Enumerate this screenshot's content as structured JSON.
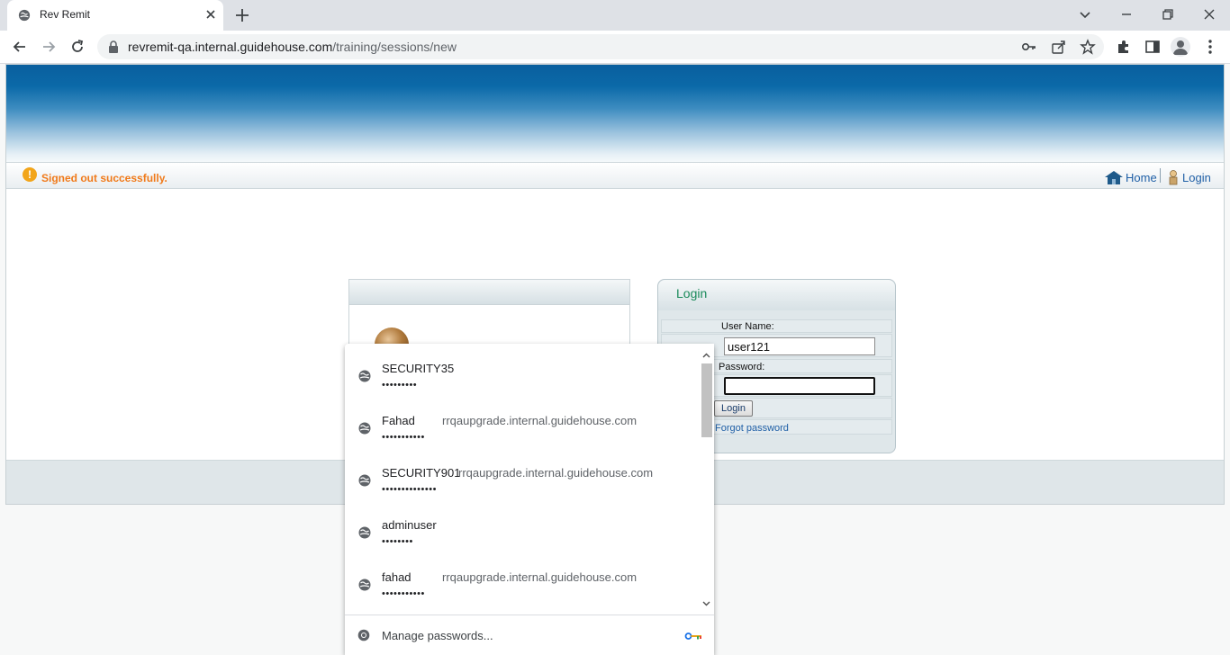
{
  "browser": {
    "tab_title": "Rev Remit",
    "url_host": "revremit-qa.internal.guidehouse.com",
    "url_path": "/training/sessions/new"
  },
  "header": {
    "flash_message": "Signed out successfully.",
    "home_link": "Home",
    "login_link": "Login",
    "accent_color": "#f07a1a",
    "link_color": "#1f5fa6"
  },
  "login": {
    "title": "Login",
    "username_label": "User Name:",
    "username_value": "user121",
    "password_label": "Password:",
    "password_value": "",
    "button_label": "Login",
    "forgot_link": "Forgot password"
  },
  "password_dropdown": {
    "items": [
      {
        "username": "SECURITY35",
        "site": "",
        "masked": "•••••••••"
      },
      {
        "username": "Fahad",
        "site": "rrqaupgrade.internal.guidehouse.com",
        "masked": "•••••••••••"
      },
      {
        "username": "SECURITY901",
        "site": "rrqaupgrade.internal.guidehouse.com",
        "masked": "••••••••••••••"
      },
      {
        "username": "adminuser",
        "site": "",
        "masked": "••••••••"
      },
      {
        "username": "fahad",
        "site": "rrqaupgrade.internal.guidehouse.com",
        "masked": "•••••••••••"
      }
    ],
    "manage_label": "Manage passwords..."
  }
}
